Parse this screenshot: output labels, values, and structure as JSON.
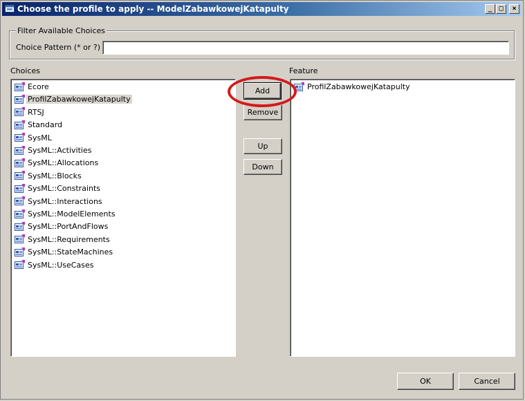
{
  "window": {
    "title": "Choose the profile to apply -- ModelZabawkowejKatapulty",
    "controls": {
      "minimize": "_",
      "maximize": "□",
      "close": "×"
    }
  },
  "filter": {
    "group_label": "Filter Available Choices",
    "pattern_label": "Choice Pattern (* or ?)",
    "pattern_value": ""
  },
  "choices": {
    "label": "Choices",
    "selected_index": 1,
    "items": [
      "Ecore",
      "ProfilZabawkowejKatapulty",
      "RTSJ",
      "Standard",
      "SysML",
      "SysML::Activities",
      "SysML::Allocations",
      "SysML::Blocks",
      "SysML::Constraints",
      "SysML::Interactions",
      "SysML::ModelElements",
      "SysML::PortAndFlows",
      "SysML::Requirements",
      "SysML::StateMachines",
      "SysML::UseCases"
    ]
  },
  "feature": {
    "label": "Feature",
    "items": [
      "ProfilZabawkowejKatapulty"
    ]
  },
  "buttons": {
    "add": "Add",
    "remove": "Remove",
    "up": "Up",
    "down": "Down",
    "ok": "OK",
    "cancel": "Cancel"
  },
  "colors": {
    "dialog_bg": "#d4d0c8",
    "titlebar_start": "#0a246a",
    "titlebar_end": "#a6caf0",
    "annotation_ring": "#d31a1a"
  },
  "icons": {
    "window": "profile-window-icon",
    "list_item": "profile-package-icon"
  }
}
